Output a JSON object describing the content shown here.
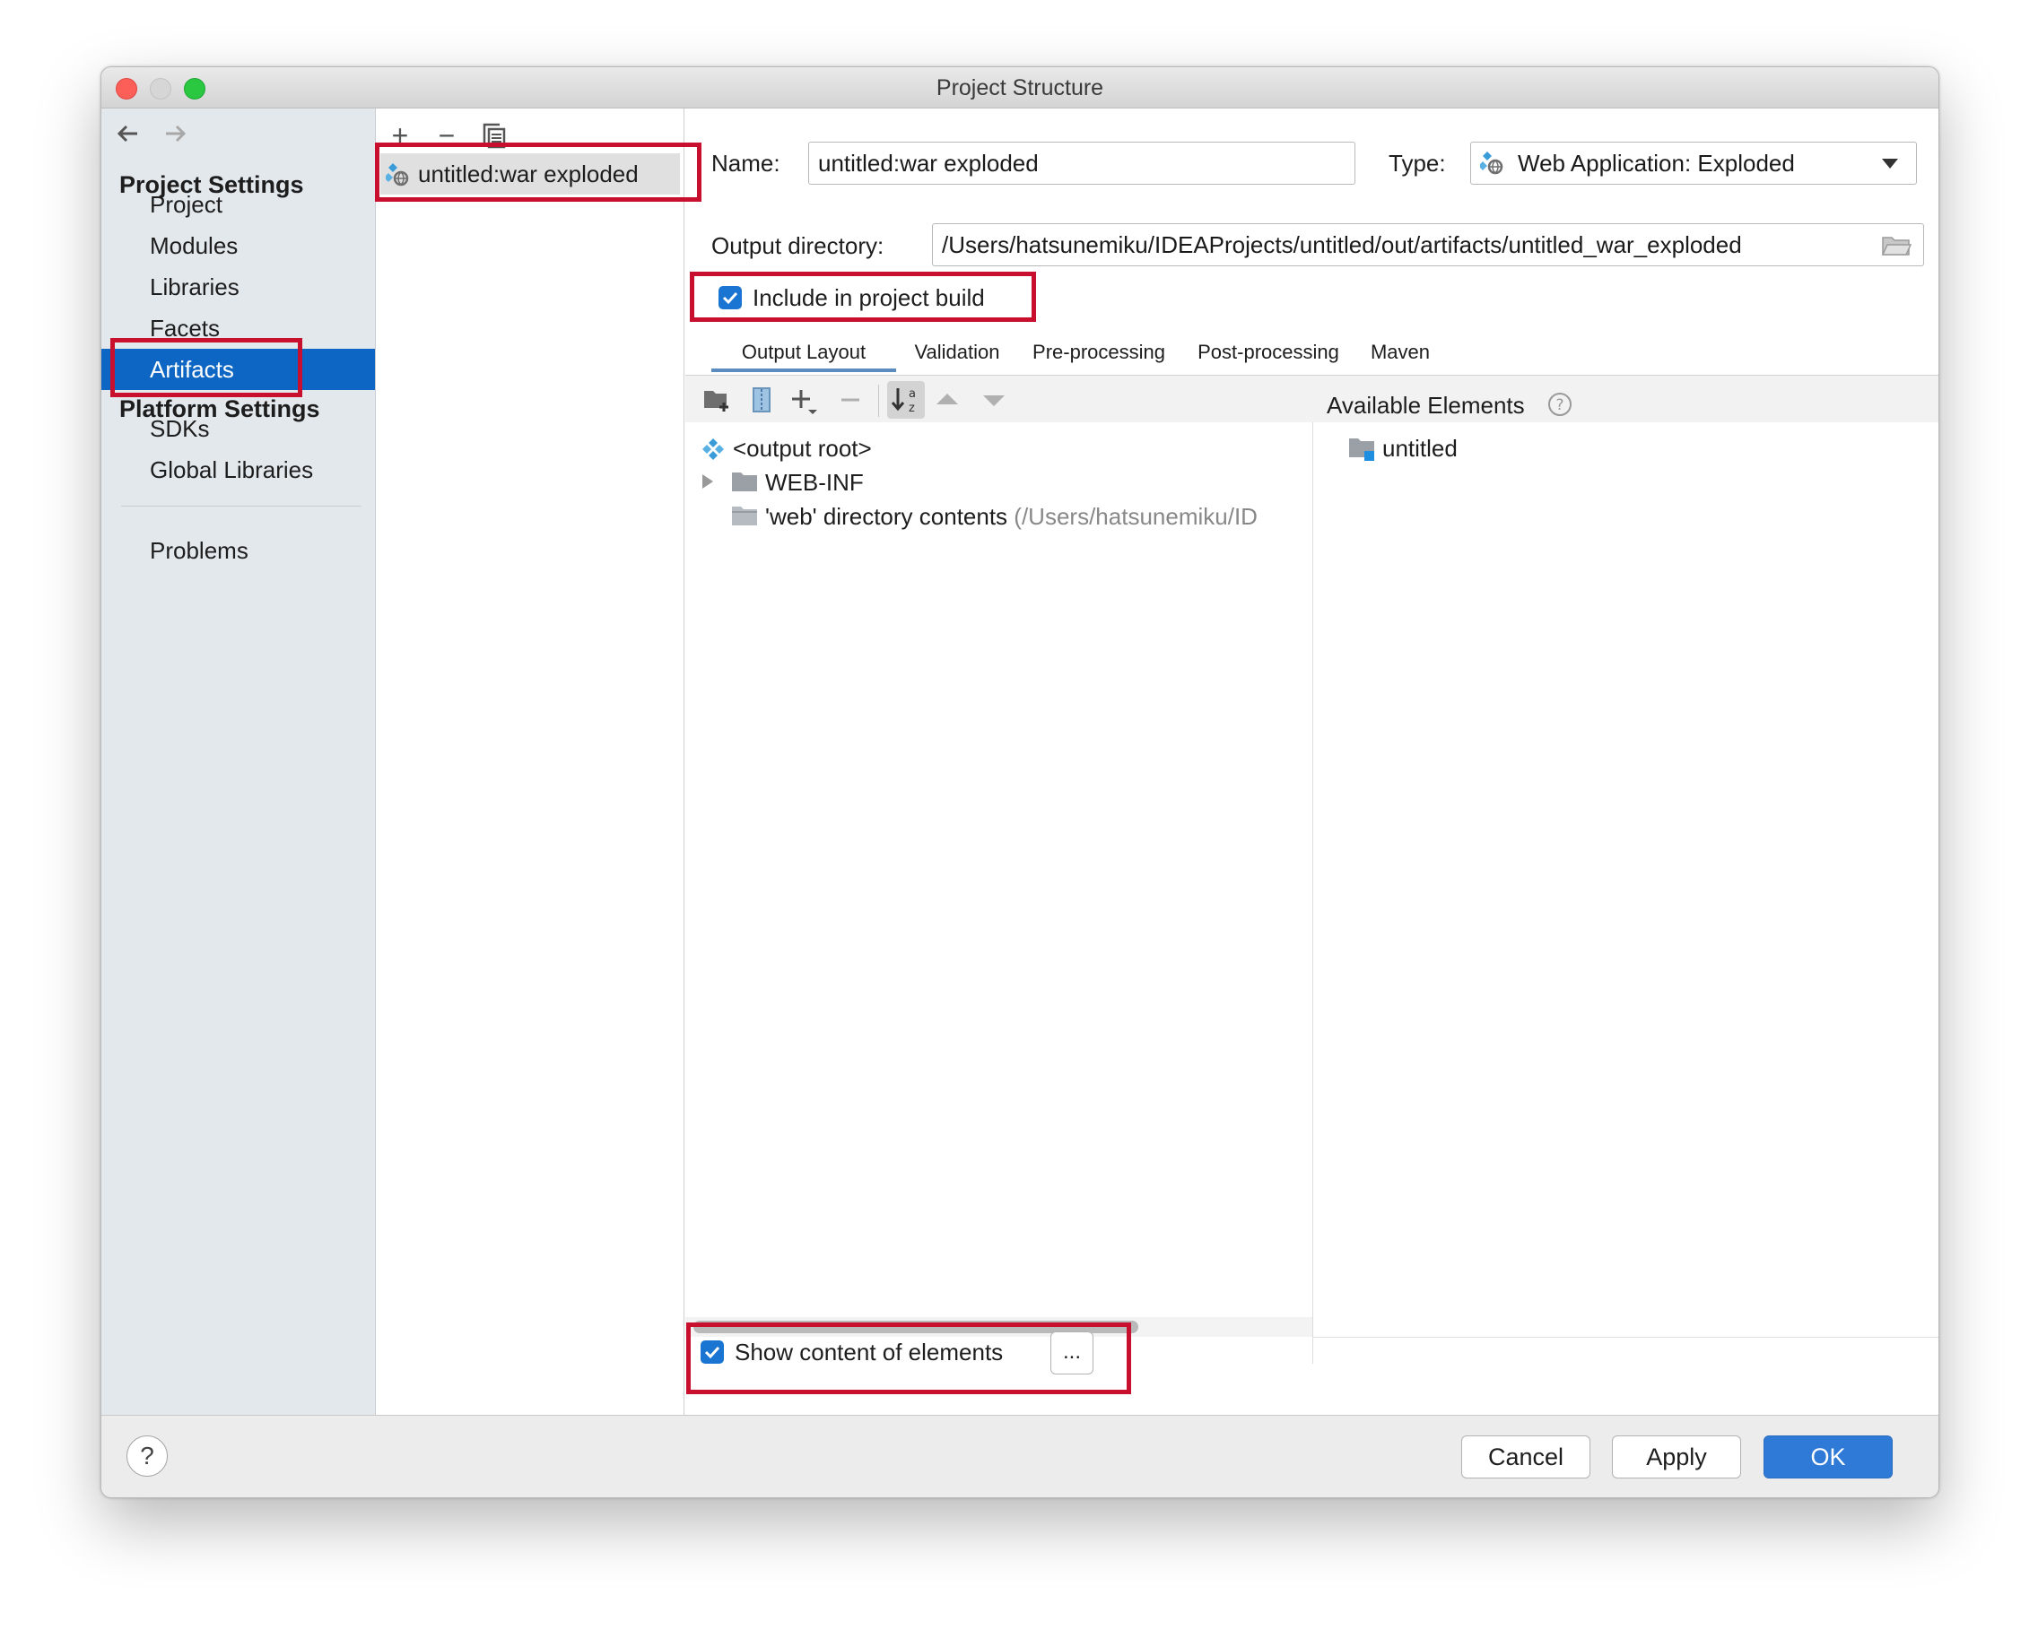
{
  "window": {
    "title": "Project Structure"
  },
  "sidebar": {
    "project_settings_heading": "Project Settings",
    "project_items": [
      "Project",
      "Modules",
      "Libraries",
      "Facets",
      "Artifacts"
    ],
    "selected": "Artifacts",
    "platform_settings_heading": "Platform Settings",
    "platform_items": [
      "SDKs",
      "Global Libraries"
    ],
    "problems": "Problems"
  },
  "artifacts_list": {
    "toolbar": {
      "add": "+",
      "remove": "−"
    },
    "items": [
      "untitled:war exploded"
    ]
  },
  "artifact": {
    "name_label": "Name:",
    "name_value": "untitled:war exploded",
    "type_label": "Type:",
    "type_value": "Web Application: Exploded",
    "output_dir_label": "Output directory:",
    "output_dir_value": "/Users/hatsunemiku/IDEAProjects/untitled/out/artifacts/untitled_war_exploded",
    "include_in_build_label": "Include in project build",
    "include_in_build_checked": true
  },
  "tabs": [
    "Output Layout",
    "Validation",
    "Pre-processing",
    "Post-processing",
    "Maven"
  ],
  "active_tab": "Output Layout",
  "layout_tree": {
    "items": [
      "<output root>",
      "WEB-INF",
      "'web' directory contents"
    ],
    "web_path_suffix": "(/Users/hatsunemiku/ID"
  },
  "available_elements": {
    "heading": "Available Elements",
    "items": [
      "untitled"
    ]
  },
  "show_content": {
    "label": "Show content of elements",
    "checked": true,
    "more_button": "..."
  },
  "footer": {
    "help": "?",
    "cancel": "Cancel",
    "apply": "Apply",
    "ok": "OK"
  },
  "colors": {
    "accent": "#0e66c4",
    "highlight": "#c8102e",
    "primary_button": "#2f7ad6"
  }
}
